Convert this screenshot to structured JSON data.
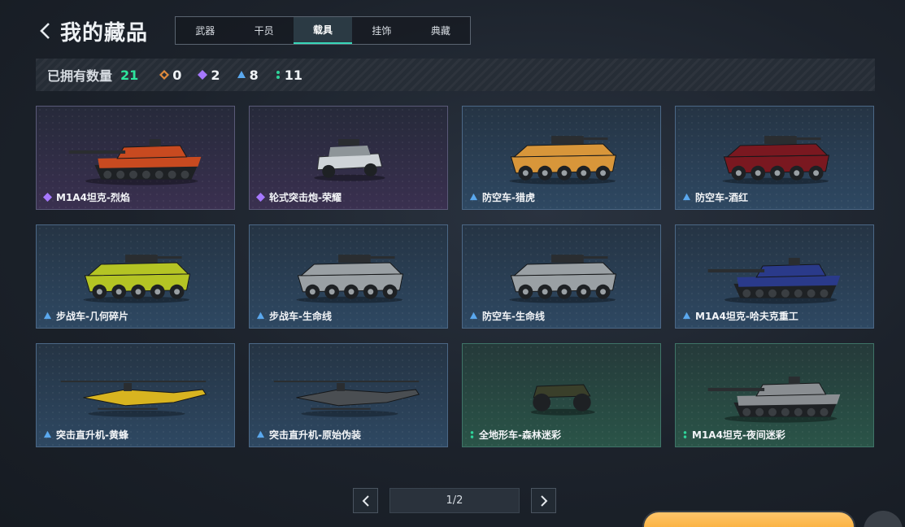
{
  "header": {
    "title": "我的藏品"
  },
  "tabs": [
    {
      "label": "武器",
      "active": false
    },
    {
      "label": "干员",
      "active": false
    },
    {
      "label": "载具",
      "active": true
    },
    {
      "label": "挂饰",
      "active": false
    },
    {
      "label": "典藏",
      "active": false
    }
  ],
  "stats": {
    "owned_label": "已拥有数量",
    "owned_total": "21",
    "rarity_counts": [
      {
        "rarity": "orange",
        "icon": "orange-diamond-icon",
        "count": "0",
        "color": "#e08a3c"
      },
      {
        "rarity": "purple",
        "icon": "purple-diamond-icon",
        "count": "2",
        "color": "#a678ff"
      },
      {
        "rarity": "blue",
        "icon": "blue-triangle-icon",
        "count": "8",
        "color": "#5aa8ee"
      },
      {
        "rarity": "green",
        "icon": "green-dots-icon",
        "count": "11",
        "color": "#2fd49a"
      }
    ]
  },
  "items": [
    {
      "name": "M1A4坦克-烈焰",
      "rarity": "purple",
      "kind": "tank",
      "skin": "#c84a20"
    },
    {
      "name": "轮式突击炮-荣耀",
      "rarity": "purple",
      "kind": "buggy",
      "skin": "#cfd4d8"
    },
    {
      "name": "防空车-猎虎",
      "rarity": "blue",
      "kind": "apc",
      "skin": "#d8963a"
    },
    {
      "name": "防空车-酒红",
      "rarity": "blue",
      "kind": "apc",
      "skin": "#7a1820"
    },
    {
      "name": "步战车-几何碎片",
      "rarity": "blue",
      "kind": "apc",
      "skin": "#b4c424"
    },
    {
      "name": "步战车-生命线",
      "rarity": "blue",
      "kind": "apc",
      "skin": "#9aa0a4"
    },
    {
      "name": "防空车-生命线",
      "rarity": "blue",
      "kind": "apc",
      "skin": "#9aa0a4"
    },
    {
      "name": "M1A4坦克-哈夫克重工",
      "rarity": "blue",
      "kind": "tank",
      "skin": "#2a3a8a"
    },
    {
      "name": "突击直升机-黄蜂",
      "rarity": "blue",
      "kind": "heli",
      "skin": "#d8b420"
    },
    {
      "name": "突击直升机-原始伪装",
      "rarity": "blue",
      "kind": "heli",
      "skin": "#4a4e52"
    },
    {
      "name": "全地形车-森林迷彩",
      "rarity": "green",
      "kind": "atv",
      "skin": "#3a3f2a"
    },
    {
      "name": "M1A4坦克-夜间迷彩",
      "rarity": "green",
      "kind": "tank2",
      "skin": "#8a8e92"
    }
  ],
  "pager": {
    "label": "1/2"
  }
}
